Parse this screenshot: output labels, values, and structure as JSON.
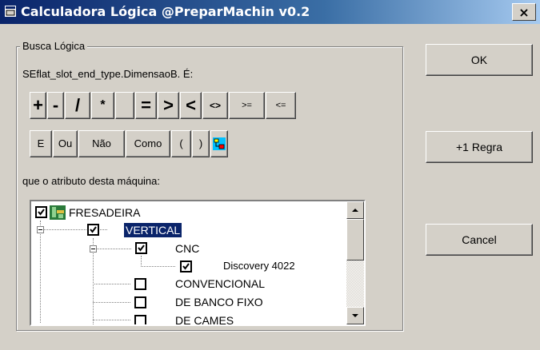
{
  "window": {
    "title": "Calculadora Lógica @PreparMachin v0.2",
    "close_glyph": "×"
  },
  "group": {
    "legend": "Busca Lógica",
    "expression": "SEflat_slot_end_type.DimensaoB. É:",
    "operators": [
      "+",
      "-",
      "/",
      "*",
      "",
      "=",
      ">",
      "<",
      "<>",
      ">=",
      "<="
    ],
    "logic_buttons": [
      "E",
      "Ou",
      "Não",
      "Como",
      "(",
      ")"
    ],
    "attribute_label": "que o atributo desta máquina:"
  },
  "tree": {
    "nodes": [
      {
        "label": "FRESADEIRA",
        "checked": true,
        "icon": "machine-icon"
      },
      {
        "label": "VERTICAL",
        "checked": true,
        "selected": true
      },
      {
        "label": "CNC",
        "checked": true
      },
      {
        "label": "Discovery 4022",
        "checked": true
      },
      {
        "label": "CONVENCIONAL",
        "checked": false
      },
      {
        "label": "DE BANCO FIXO",
        "checked": false
      },
      {
        "label": "DE CAMES",
        "checked": false
      }
    ]
  },
  "buttons": {
    "ok": "OK",
    "add_rule": "+1 Regra",
    "cancel": "Cancel"
  },
  "colors": {
    "titlebar_start": "#0a246a",
    "titlebar_end": "#a6caf0",
    "face": "#d4d0c8",
    "selection": "#0a246a"
  }
}
